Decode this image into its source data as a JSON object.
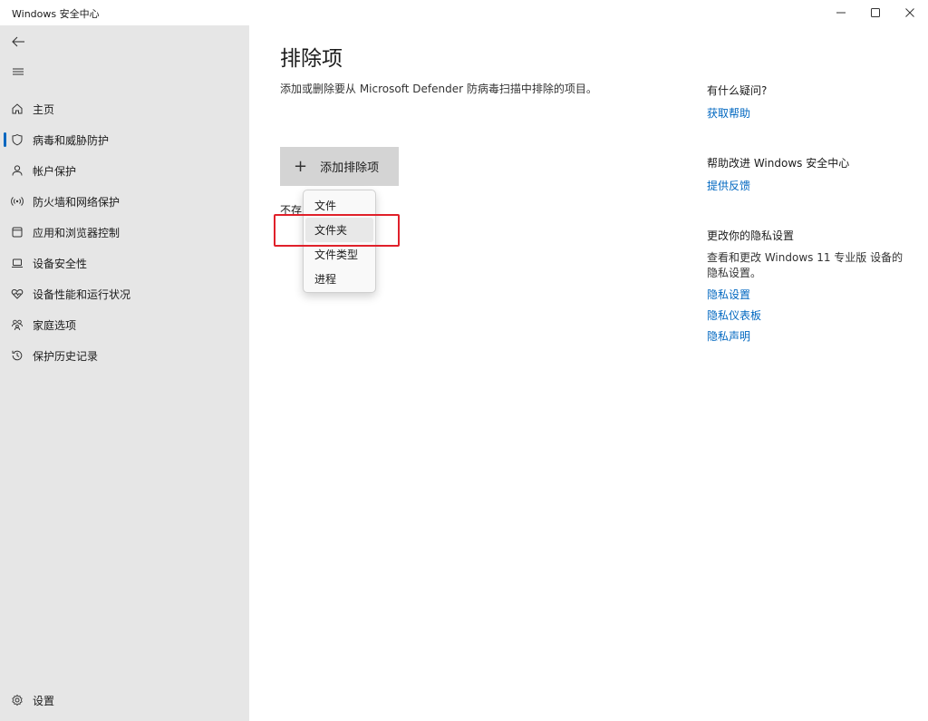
{
  "window": {
    "title": "Windows 安全中心"
  },
  "sidebar": {
    "items": [
      {
        "label": "主页",
        "icon": "home-icon"
      },
      {
        "label": "病毒和威胁防护",
        "icon": "shield-icon"
      },
      {
        "label": "帐户保护",
        "icon": "person-icon"
      },
      {
        "label": "防火墙和网络保护",
        "icon": "wireless-icon"
      },
      {
        "label": "应用和浏览器控制",
        "icon": "app-window-icon"
      },
      {
        "label": "设备安全性",
        "icon": "laptop-icon"
      },
      {
        "label": "设备性能和运行状况",
        "icon": "heart-pulse-icon"
      },
      {
        "label": "家庭选项",
        "icon": "family-icon"
      },
      {
        "label": "保护历史记录",
        "icon": "history-icon"
      }
    ],
    "active_index": 1,
    "settings_label": "设置"
  },
  "main": {
    "title": "排除项",
    "description": "添加或删除要从 Microsoft Defender 防病毒扫描中排除的项目。",
    "add_button_label": "添加排除项",
    "empty_text": "不存",
    "dropdown": {
      "items": [
        "文件",
        "文件夹",
        "文件类型",
        "进程"
      ],
      "hovered_index": 1
    }
  },
  "right_panel": {
    "help_heading": "有什么疑问?",
    "help_link": "获取帮助",
    "improve_heading": "帮助改进 Windows 安全中心",
    "feedback_link": "提供反馈",
    "privacy_heading": "更改你的隐私设置",
    "privacy_text": "查看和更改 Windows 11 专业版 设备的隐私设置。",
    "privacy_links": [
      "隐私设置",
      "隐私仪表板",
      "隐私声明"
    ]
  },
  "colors": {
    "accent": "#0067c0",
    "sidebar_bg": "#e6e6e6",
    "highlight": "#e0202a"
  }
}
